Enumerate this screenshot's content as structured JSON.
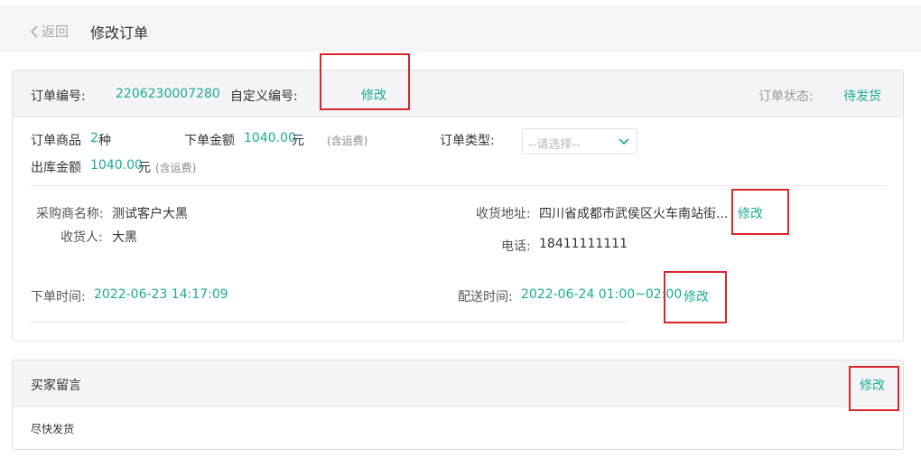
{
  "header": {
    "back_label": "返回",
    "page_title": "修改订单"
  },
  "order": {
    "number_label": "订单编号:",
    "number_value": "2206230007280",
    "custom_number_label": "自定义编号:",
    "custom_number_edit": "修改",
    "status_label": "订单状态:",
    "status_value": "待发货"
  },
  "summary": {
    "goods_label": "订单商品",
    "goods_count": "2",
    "goods_unit": "种",
    "amount_label": "下单金额",
    "amount_value": "1040.00",
    "amount_unit": "元",
    "amount_note": "(含运费)",
    "type_label": "订单类型:",
    "type_placeholder": "--请选择--",
    "outbound_label": "出库金额",
    "outbound_value": "1040.00",
    "outbound_unit": "元",
    "outbound_note": "(含运费)"
  },
  "customer": {
    "buyer_label": "采购商名称:",
    "buyer_value": "测试客户大黑",
    "receiver_label": "收货人:",
    "receiver_value": "大黑",
    "address_label": "收货地址:",
    "address_value": "四川省成都市武侯区火车南站街...",
    "address_edit": "修改",
    "phone_label": "电话:",
    "phone_value": "18411111111"
  },
  "times": {
    "order_time_label": "下单时间:",
    "order_time_value": "2022-06-23 14:17:09",
    "delivery_label": "配送时间:",
    "delivery_value": "2022-06-24 01:00~02:00",
    "delivery_edit": "修改"
  },
  "message": {
    "title": "买家留言",
    "edit": "修改",
    "content": "尽快发货"
  },
  "colors": {
    "accent": "#1aab92",
    "highlight_box": "#d9262c"
  }
}
